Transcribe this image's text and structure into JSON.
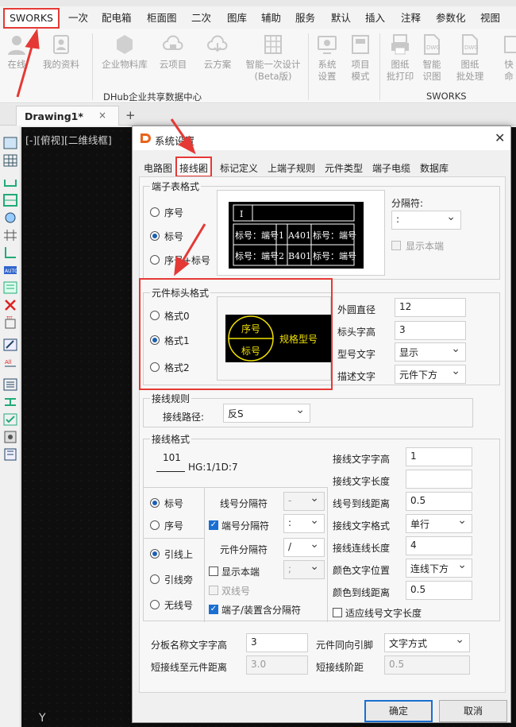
{
  "ribbon_tabs": [
    "SWORKS",
    "一次",
    "配电箱",
    "柜面图",
    "二次",
    "图库",
    "辅助",
    "服务",
    "默认",
    "插入",
    "注释",
    "参数化",
    "视图"
  ],
  "ribbon_buttons": [
    {
      "label": "在线",
      "icon": "user-online-icon"
    },
    {
      "label": "我的资料",
      "icon": "my-profile-icon"
    },
    {
      "label": "企业物料库",
      "icon": "material-library-icon"
    },
    {
      "label": "云项目",
      "icon": "cloud-project-icon"
    },
    {
      "label": "云方案",
      "icon": "cloud-solution-icon"
    },
    {
      "label": "智能一次设计\n(Beta版)",
      "icon": "smart-design-icon"
    },
    {
      "label": "系统\n设置",
      "icon": "system-settings-icon"
    },
    {
      "label": "项目\n模式",
      "icon": "project-mode-icon"
    },
    {
      "label": "图纸\n批打印",
      "icon": "batch-print-icon"
    },
    {
      "label": "智能\n识图",
      "icon": "smart-recognize-icon"
    },
    {
      "label": "图纸\n批处理",
      "icon": "batch-process-icon"
    },
    {
      "label": "快\n命",
      "icon": "quick-command-icon"
    }
  ],
  "ribbon_groups": {
    "dhub": "DHub企业共享数据中心",
    "sworks": "SWORKS"
  },
  "doc_tab": {
    "title": "Drawing1*",
    "close": "×",
    "plus": "+"
  },
  "viewport_label": "[-][俯视][二维线框]",
  "dialog": {
    "title": "系统设置",
    "tabs": [
      "电路图",
      "接线图",
      "标记定义",
      "上端子规则",
      "元件类型",
      "端子电缆",
      "数据库"
    ],
    "terminal_table": {
      "legend": "端子表格式",
      "options": [
        "序号",
        "标号",
        "序号+标号"
      ],
      "selected": 1,
      "separator_label": "分隔符:",
      "separator_value": ":",
      "show_this_terminal": "显示本端",
      "preview_header": "I",
      "preview_rows": [
        [
          "标号：端号",
          "1",
          "A401",
          "标号：端号"
        ],
        [
          "标号：端号",
          "2",
          "B401",
          "标号：端号"
        ]
      ]
    },
    "component_head": {
      "legend": "元件标头格式",
      "options": [
        "格式0",
        "格式1",
        "格式2"
      ],
      "selected": 1,
      "preview_top": "序号",
      "preview_bottom": "标号",
      "preview_side": "规格型号",
      "outer_diameter_label": "外圆直径",
      "outer_diameter": "12",
      "head_text_height_label": "标头字高",
      "head_text_height": "3",
      "model_text_label": "型号文字",
      "model_text": "显示",
      "desc_text_label": "描述文字",
      "desc_text": "元件下方"
    },
    "wiring_rule": {
      "legend": "接线规则",
      "path_label": "接线路径:",
      "path_value": "反S"
    },
    "wiring_format": {
      "legend": "接线格式",
      "sample_num": "101",
      "sample_text": "HG:1/1D:7",
      "left_opts1": [
        "标号",
        "序号"
      ],
      "left_sel1": 0,
      "left_opts2": [
        "引线上",
        "引线旁",
        "无线号"
      ],
      "left_sel2": 0,
      "line_sep_label": "线号分隔符",
      "line_sep_value": "-",
      "terminal_sep_label": "端号分隔符",
      "terminal_sep_value": ":",
      "comp_sep_label": "元件分隔符",
      "comp_sep_value": "/",
      "show_this_end": "显示本端",
      "show_this_end_value": ";",
      "double_wire": "双线号",
      "terminal_device_sep": "端子/装置含分隔符",
      "right_fields": [
        {
          "label": "接线文字字高",
          "value": "1",
          "kind": "input"
        },
        {
          "label": "接线文字长度",
          "value": "",
          "kind": "input"
        },
        {
          "label": "线号到线距离",
          "value": "0.5",
          "kind": "input"
        },
        {
          "label": "接线文字格式",
          "value": "单行",
          "kind": "select"
        },
        {
          "label": "接线连线长度",
          "value": "4",
          "kind": "input"
        },
        {
          "label": "颜色文字位置",
          "value": "连线下方",
          "kind": "select"
        },
        {
          "label": "颜色到线距离",
          "value": "0.5",
          "kind": "input"
        }
      ],
      "fit_text_length": "适应线号文字长度"
    },
    "bottom": {
      "sub_name_height_label": "分板名称文字字高",
      "sub_name_height": "3",
      "short_wire_dist_label": "短接线至元件距离",
      "short_wire_dist": "3.0",
      "same_dir_label": "元件同向引脚",
      "same_dir_value": "文字方式",
      "short_wire_step_label": "短接线阶距",
      "short_wire_step": "0.5"
    },
    "ok": "确定",
    "cancel": "取消"
  },
  "colors": {
    "annotation_red": "#e53935",
    "accent_blue": "#1a6fd1",
    "preview_yellow": "#f0e000"
  }
}
